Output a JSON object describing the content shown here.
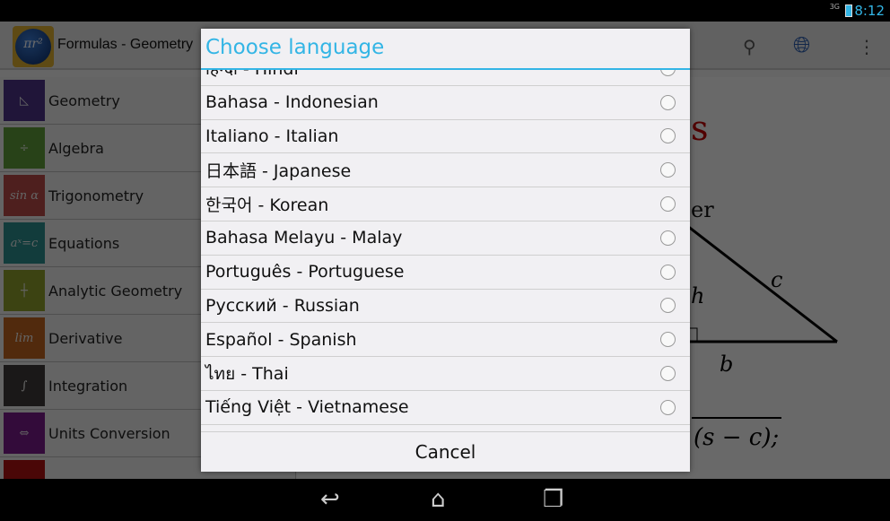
{
  "status": {
    "network": "3G",
    "time": "8:12"
  },
  "actionbar": {
    "title": "Formulas - Geometry",
    "logo_text": "πr²",
    "icons": [
      "search-icon",
      "globe-icon",
      "overflow-menu-icon"
    ]
  },
  "sidebar": {
    "items": [
      {
        "label": "Geometry",
        "icon": "triangle-icon",
        "glyph": "◺",
        "color": "#4b3388"
      },
      {
        "label": "Algebra",
        "icon": "divide-icon",
        "glyph": "÷",
        "color": "#5f9e3a"
      },
      {
        "label": "Trigonometry",
        "icon": "sin-icon",
        "glyph": "sin α",
        "color": "#b94a48"
      },
      {
        "label": "Equations",
        "icon": "equation-icon",
        "glyph": "aˣ=c",
        "color": "#2b8f8f"
      },
      {
        "label": "Analytic Geometry",
        "icon": "axes-icon",
        "glyph": "┼",
        "color": "#8fa02a"
      },
      {
        "label": "Derivative",
        "icon": "limit-icon",
        "glyph": "lim",
        "color": "#c0641e"
      },
      {
        "label": "Integration",
        "icon": "integral-icon",
        "glyph": "∫",
        "color": "#3d3a38"
      },
      {
        "label": "Units Conversion",
        "icon": "double-arrow-icon",
        "glyph": "⇔",
        "color": "#7a1a8a"
      },
      {
        "label": "",
        "icon": "unknown-icon",
        "glyph": "",
        "color": "#b01010"
      }
    ]
  },
  "content": {
    "heading_fragment": "s",
    "text_fragment": "er",
    "labels": [
      "h",
      "c",
      "b"
    ],
    "formula_fragment": "(s − c);"
  },
  "dialog": {
    "title": "Choose language",
    "cancel": "Cancel",
    "options": [
      "हिन्दी - Hindi",
      "Bahasa - Indonesian",
      "Italiano - Italian",
      "日本語 - Japanese",
      "한국어 - Korean",
      "Bahasa Melayu - Malay",
      "Português - Portuguese",
      "Русский - Russian",
      "Español - Spanish",
      "ไทย - Thai",
      "Tiếng Việt - Vietnamese"
    ],
    "selected": null
  },
  "colors": {
    "accent": "#33b5e5",
    "heading": "#c00000"
  }
}
